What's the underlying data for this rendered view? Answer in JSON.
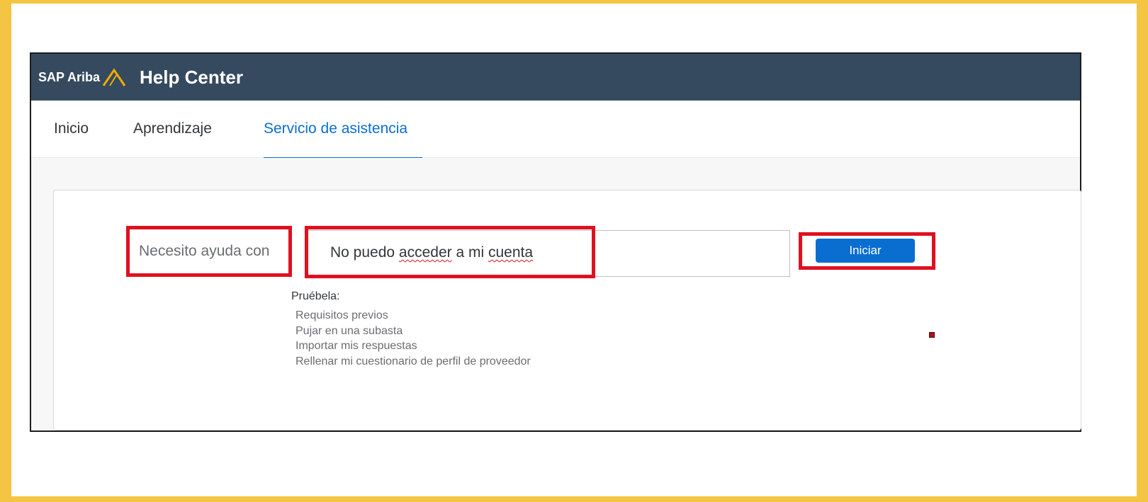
{
  "colors": {
    "frame_border": "#f4c542",
    "header_bg": "#354a5f",
    "accent": "#0a6ed1",
    "highlight": "#e0101e"
  },
  "header": {
    "brand_prefix": "SAP Ariba",
    "logo_icon": "ariba-chevron-icon",
    "title": "Help Center"
  },
  "tabs": [
    {
      "label": "Inicio",
      "active": false
    },
    {
      "label": "Aprendizaje",
      "active": false
    },
    {
      "label": "Servicio de asistencia",
      "active": true
    }
  ],
  "help_form": {
    "label": "Necesito ayuda con",
    "search_value_parts": [
      "No puedo ",
      "acceder",
      " a mi ",
      "cuenta"
    ],
    "button_label": "Iniciar",
    "try_label": "Pruébela:",
    "suggestions": [
      "Requisitos previos",
      "Pujar en una subasta",
      "Importar mis respuestas",
      "Rellenar mi cuestionario de perfil de proveedor"
    ]
  }
}
